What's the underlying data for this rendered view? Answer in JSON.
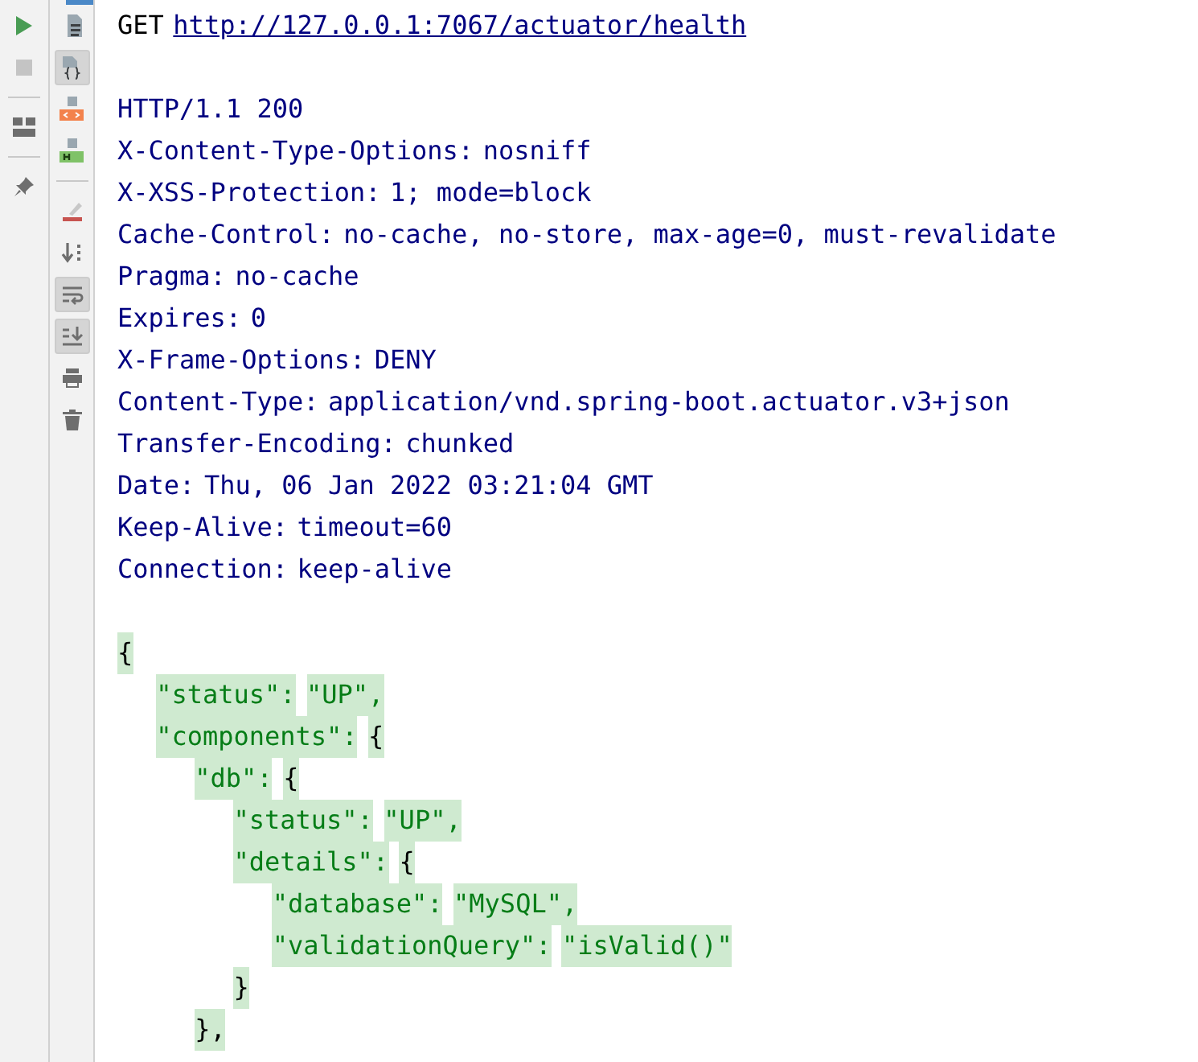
{
  "left_toolbar": [
    {
      "kind": "run"
    },
    {
      "kind": "stop"
    },
    {
      "kind": "divider"
    },
    {
      "kind": "layout"
    },
    {
      "kind": "divider"
    },
    {
      "kind": "pin"
    }
  ],
  "format_toolbar": [
    {
      "kind": "text",
      "selected": false
    },
    {
      "kind": "json",
      "selected": true
    },
    {
      "kind": "html",
      "selected": false
    },
    {
      "kind": "h",
      "selected": false
    },
    {
      "kind": "divider"
    },
    {
      "kind": "clear",
      "selected": false
    },
    {
      "kind": "sort",
      "selected": false
    },
    {
      "kind": "wrap",
      "selected": true
    },
    {
      "kind": "scroll",
      "selected": true
    },
    {
      "kind": "print",
      "selected": false
    },
    {
      "kind": "delete",
      "selected": false
    }
  ],
  "request": {
    "method": "GET",
    "url": "http://127.0.0.1:7067/actuator/health"
  },
  "response": {
    "status_line": "HTTP/1.1 200",
    "headers": [
      {
        "name": "X-Content-Type-Options:",
        "value": "nosniff"
      },
      {
        "name": "X-XSS-Protection:",
        "value": "1; mode=block"
      },
      {
        "name": "Cache-Control:",
        "value": "no-cache, no-store, max-age=0, must-revalidate"
      },
      {
        "name": "Pragma:",
        "value": "no-cache"
      },
      {
        "name": "Expires:",
        "value": "0"
      },
      {
        "name": "X-Frame-Options:",
        "value": "DENY"
      },
      {
        "name": "Content-Type:",
        "value": "application/vnd.spring-boot.actuator.v3+json"
      },
      {
        "name": "Transfer-Encoding:",
        "value": "chunked"
      },
      {
        "name": "Date:",
        "value": "Thu, 06 Jan 2022 03:21:04 GMT"
      },
      {
        "name": "Keep-Alive:",
        "value": "timeout=60"
      },
      {
        "name": "Connection:",
        "value": "keep-alive"
      }
    ],
    "body": {
      "open": "{",
      "children": [
        {
          "key": "\"status\":",
          "value": "\"UP\","
        },
        {
          "key": "\"components\":",
          "open": "{",
          "children": [
            {
              "key": "\"db\":",
              "open": "{",
              "children": [
                {
                  "key": "\"status\":",
                  "value": "\"UP\","
                },
                {
                  "key": "\"details\":",
                  "open": "{",
                  "children": [
                    {
                      "key": "\"database\":",
                      "value": "\"MySQL\","
                    },
                    {
                      "key": "\"validationQuery\":",
                      "value": "\"isValid()\""
                    }
                  ],
                  "close": "}"
                }
              ],
              "close": "},"
            }
          ]
        }
      ]
    }
  }
}
